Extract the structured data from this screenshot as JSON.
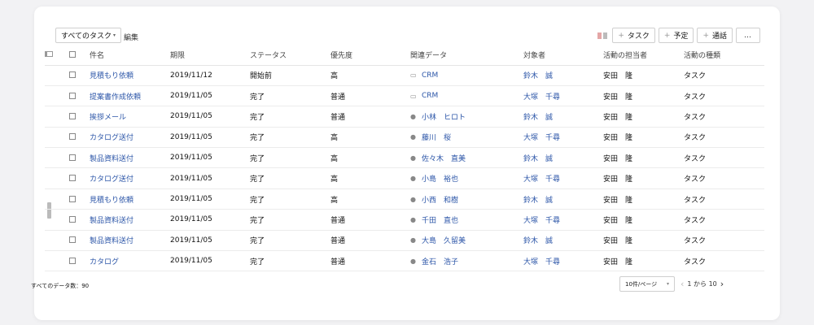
{
  "toolbar": {
    "view_label": "すべてのタスク",
    "edit_label": "編集",
    "add_task_label": "タスク",
    "add_event_label": "予定",
    "add_call_label": "通話",
    "more_label": "…"
  },
  "columns": {
    "subject": "件名",
    "due": "期限",
    "status": "ステータス",
    "priority": "優先度",
    "related": "関連データ",
    "target": "対象者",
    "owner": "活動の担当者",
    "type": "活動の種類"
  },
  "rows": [
    {
      "subject": "見積もり依頼",
      "due": "2019/11/12",
      "status": "開始前",
      "priority": "高",
      "related_icon": "folder-icon",
      "related": "CRM",
      "target": "鈴木　誠",
      "owner": "安田　隆",
      "type": "タスク"
    },
    {
      "subject": "提案書作成依頼",
      "due": "2019/11/05",
      "status": "完了",
      "priority": "普通",
      "related_icon": "folder-icon",
      "related": "CRM",
      "target": "大塚　千尋",
      "owner": "安田　隆",
      "type": "タスク"
    },
    {
      "subject": "挨拶メール",
      "due": "2019/11/05",
      "status": "完了",
      "priority": "普通",
      "related_icon": "contact-icon",
      "related": "小林　ヒロト",
      "target": "鈴木　誠",
      "owner": "安田　隆",
      "type": "タスク"
    },
    {
      "subject": "カタログ送付",
      "due": "2019/11/05",
      "status": "完了",
      "priority": "高",
      "related_icon": "contact-icon",
      "related": "藤川　桜",
      "target": "大塚　千尋",
      "owner": "安田　隆",
      "type": "タスク"
    },
    {
      "subject": "製品資料送付",
      "due": "2019/11/05",
      "status": "完了",
      "priority": "高",
      "related_icon": "contact-icon",
      "related": "佐々木　直美",
      "target": "鈴木　誠",
      "owner": "安田　隆",
      "type": "タスク"
    },
    {
      "subject": "カタログ送付",
      "due": "2019/11/05",
      "status": "完了",
      "priority": "高",
      "related_icon": "contact-icon",
      "related": "小島　裕也",
      "target": "大塚　千尋",
      "owner": "安田　隆",
      "type": "タスク"
    },
    {
      "subject": "見積もり依頼",
      "due": "2019/11/05",
      "status": "完了",
      "priority": "高",
      "related_icon": "contact-icon",
      "related": "小西　和樹",
      "target": "鈴木　誠",
      "owner": "安田　隆",
      "type": "タスク"
    },
    {
      "subject": "製品資料送付",
      "due": "2019/11/05",
      "status": "完了",
      "priority": "普通",
      "related_icon": "contact-icon",
      "related": "千田　直也",
      "target": "大塚　千尋",
      "owner": "安田　隆",
      "type": "タスク"
    },
    {
      "subject": "製品資料送付",
      "due": "2019/11/05",
      "status": "完了",
      "priority": "普通",
      "related_icon": "contact-icon",
      "related": "大島　久留美",
      "target": "鈴木　誠",
      "owner": "安田　隆",
      "type": "タスク"
    },
    {
      "subject": "カタログ",
      "due": "2019/11/05",
      "status": "完了",
      "priority": "普通",
      "related_icon": "contact-icon",
      "related": "金石　浩子",
      "target": "大塚　千尋",
      "owner": "安田　隆",
      "type": "タスク"
    }
  ],
  "footer": {
    "total_label": "すべてのデータ数：90",
    "per_page": "10件/ページ",
    "page_range": "1 から 10"
  },
  "colors": {
    "link": "#2c56a8",
    "layout_icon_left": "#e4a6a6",
    "layout_icon_right": "#bbbbbb"
  }
}
